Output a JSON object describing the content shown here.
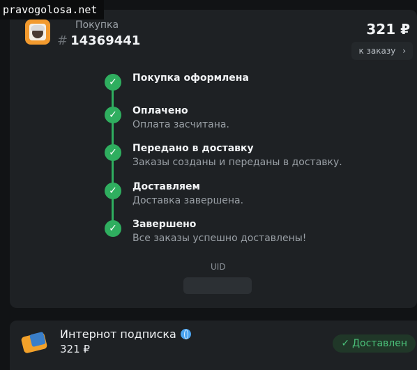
{
  "watermark": "pravogolosa.net",
  "order": {
    "label": "Покупка",
    "hash": "#",
    "number": "14369441",
    "price": "321 ₽",
    "to_order_label": "к заказу",
    "chevron": "›"
  },
  "timeline": [
    {
      "title": "Покупка оформлена",
      "desc": ""
    },
    {
      "title": "Оплачено",
      "desc": "Оплата засчитана."
    },
    {
      "title": "Передано в доставку",
      "desc": "Заказы созданы и переданы в доставку."
    },
    {
      "title": "Доставляем",
      "desc": "Доставка завершена."
    },
    {
      "title": "Завершено",
      "desc": "Все заказы успешно доставлены!"
    }
  ],
  "check_glyph": "✓",
  "uid": {
    "label": "UID",
    "value": ""
  },
  "item": {
    "name": "Интернот подписка",
    "price": "321 ₽",
    "status": "Доставлен",
    "status_glyph": "✓"
  },
  "colors": {
    "accent_green": "#2fae5f",
    "background": "#111315",
    "card": "#1e2124"
  }
}
